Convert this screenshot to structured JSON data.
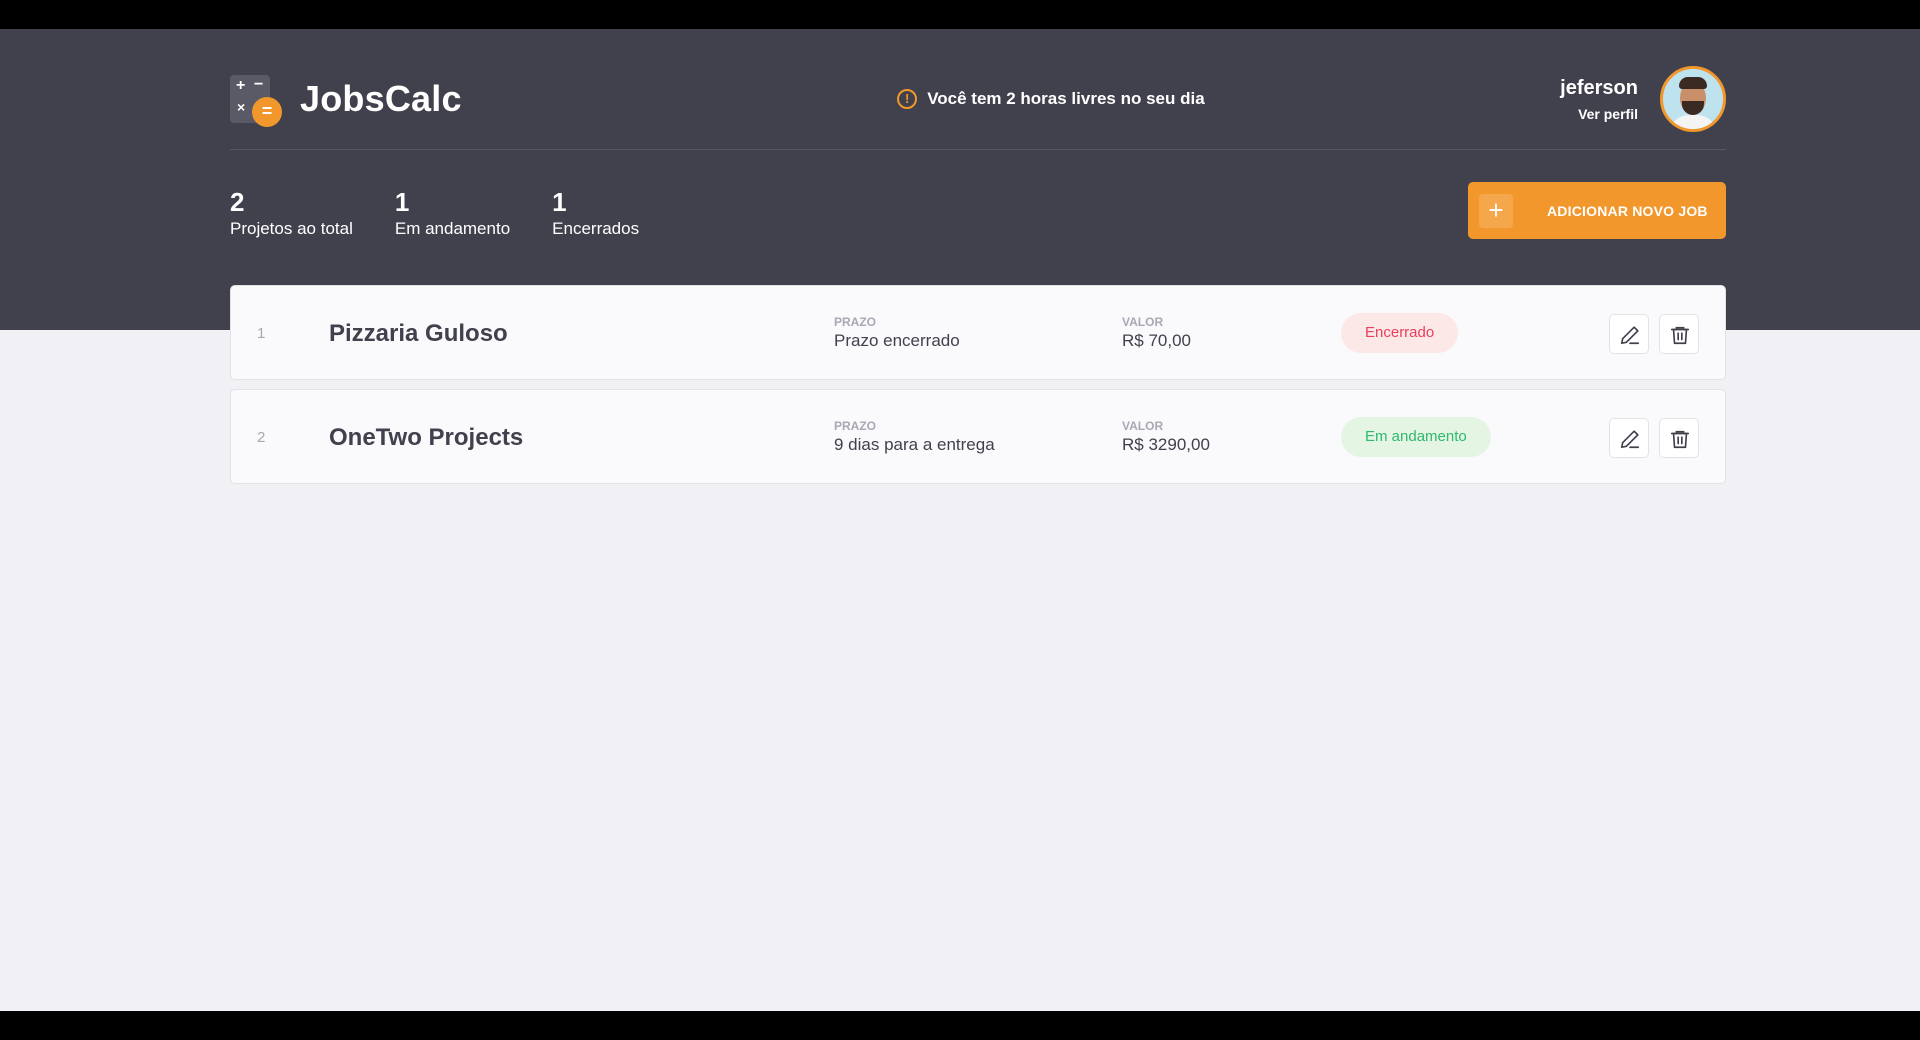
{
  "app": {
    "name": "JobsCalc"
  },
  "header": {
    "notice": "Você tem 2 horas livres no seu dia",
    "profile": {
      "name": "jeferson",
      "link_label": "Ver perfil"
    }
  },
  "summary": {
    "total": {
      "value": "2",
      "label": "Projetos ao total"
    },
    "progress": {
      "value": "1",
      "label": "Em andamento"
    },
    "closed": {
      "value": "1",
      "label": "Encerrados"
    }
  },
  "add_button": {
    "label": "ADICIONAR NOVO JOB"
  },
  "jobs": [
    {
      "id": "1",
      "name": "Pizzaria Guloso",
      "deadline_title": "PRAZO",
      "deadline": "Prazo encerrado",
      "value_title": "VALOR",
      "value": "R$ 70,00",
      "status": "Encerrado"
    },
    {
      "id": "2",
      "name": "OneTwo Projects",
      "deadline_title": "PRAZO",
      "deadline": "9 dias para a entrega",
      "value_title": "VALOR",
      "value": "R$ 3290,00",
      "status": "Em andamento"
    }
  ],
  "colors": {
    "header_bg": "#41414d",
    "accent": "#f1972c",
    "page_bg": "#f0f0f5",
    "closed_badge": "#e83f5b",
    "progress_badge": "#2fb86e"
  },
  "icons": {
    "logo": "calculator-logo-icon",
    "notice": "alert-circle-icon",
    "add": "plus-icon",
    "edit": "pencil-icon",
    "delete": "trash-icon"
  }
}
